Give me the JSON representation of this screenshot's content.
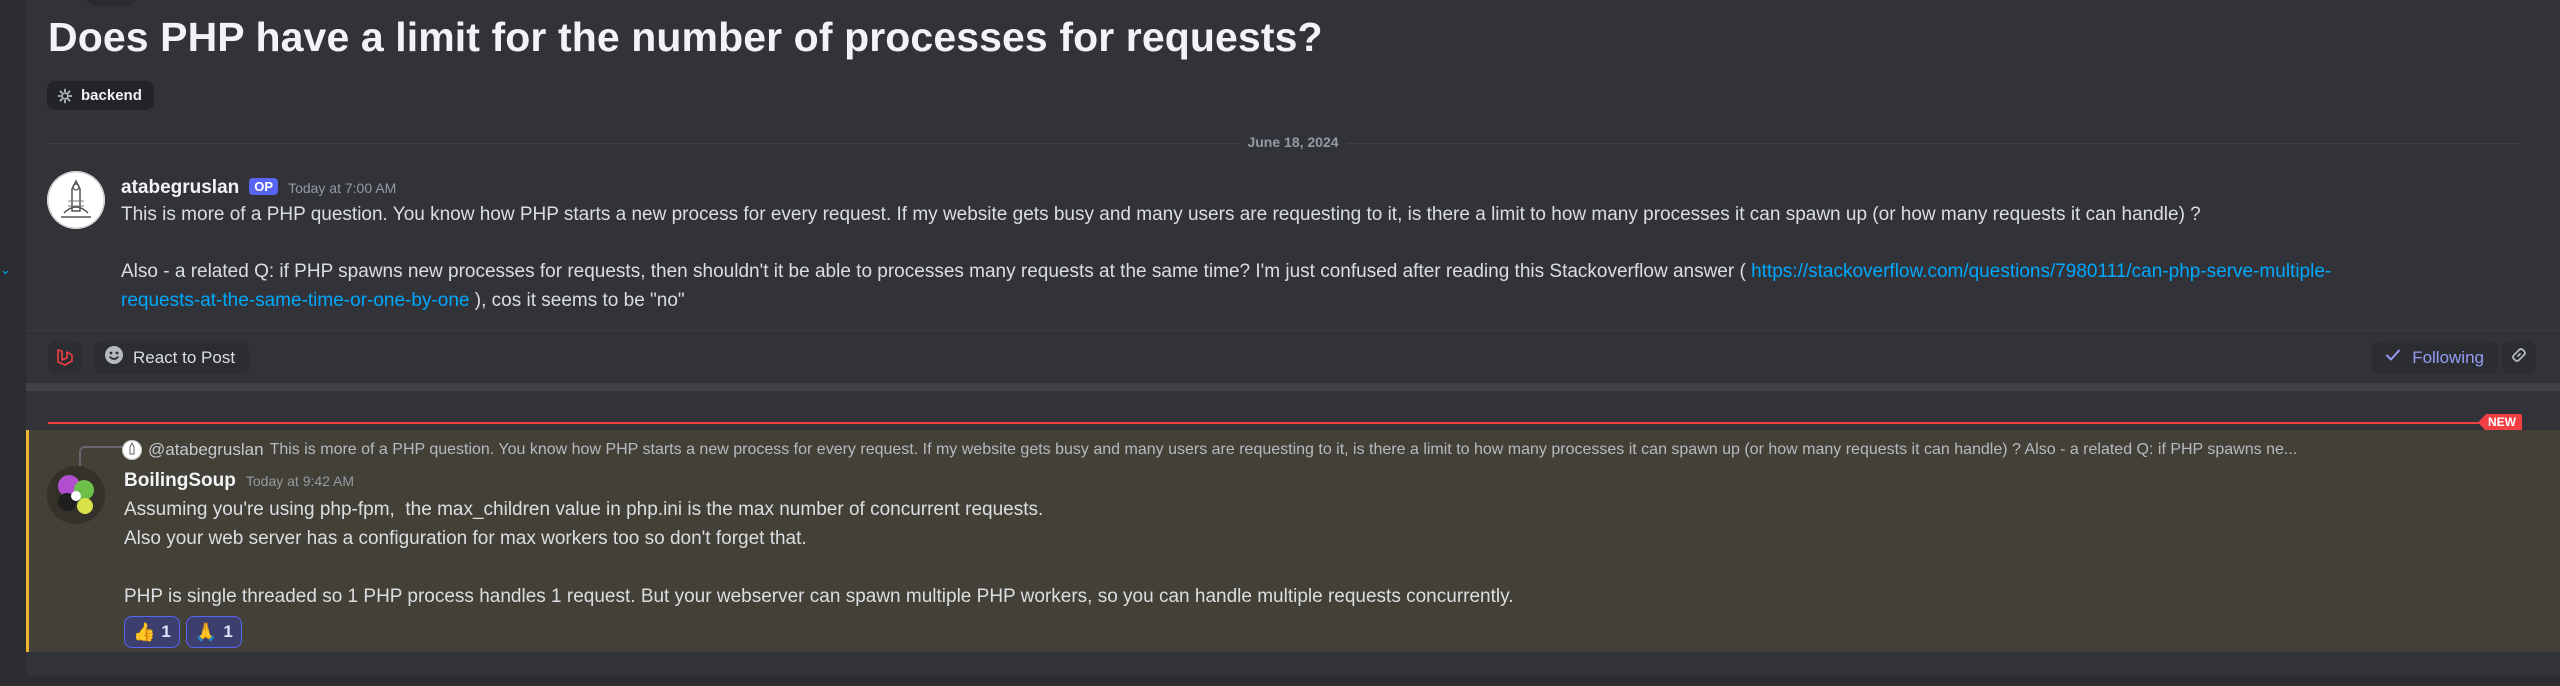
{
  "thread": {
    "title": "Does PHP have a limit for the number of processes for requests?",
    "tag": "backend",
    "date_divider": "June 18, 2024"
  },
  "post": {
    "author": "atabegruslan",
    "badge": "OP",
    "timestamp": "Today at 7:00 AM",
    "paragraph1": "This is more of a PHP question. You know how PHP starts a new process for every request. If my website gets busy and many users are requesting to it, is there a limit to how many processes it can spawn up (or how many requests it can handle) ?",
    "paragraph2_before": "Also - a related Q: if PHP spawns new processes for requests, then shouldn't it be able to processes many requests at the same time? I'm just confused after reading this Stackoverflow answer ( ",
    "link_line1": "https://stackoverflow.com/questions/7980111/can-php-serve-multiple-",
    "link_line2": "requests-at-the-same-time-or-one-by-one",
    "paragraph2_after": " ), cos it seems to be \"no\""
  },
  "actions": {
    "react_label": "React to Post",
    "following_label": "Following"
  },
  "new_badge": "NEW",
  "reply": {
    "ref_author": "@atabegruslan",
    "ref_snippet": "This is more of a PHP question. You know how PHP starts a new process for every request. If my website gets busy and many users are requesting to it, is there a limit to how many processes it can spawn up (or how many requests it can handle) ?  Also - a related Q: if PHP spawns ne...",
    "author": "BoilingSoup",
    "timestamp": "Today at 9:42 AM",
    "line1": "Assuming you're using php-fpm,  the max_children value in php.ini is the max number of concurrent requests.",
    "line2": "Also your web server has a configuration for max workers too so don't forget that.",
    "line3": "PHP is single threaded so 1 PHP process handles 1 request. But your webserver can spawn multiple PHP workers, so you can handle multiple requests concurrently.",
    "reactions": [
      {
        "emoji": "👍",
        "count": "1"
      },
      {
        "emoji": "🙏",
        "count": "1"
      }
    ]
  },
  "colors": {
    "accent": "#5865f2",
    "link": "#00a8fc",
    "new_line": "#f23f43",
    "highlight_border": "#f0b232"
  }
}
